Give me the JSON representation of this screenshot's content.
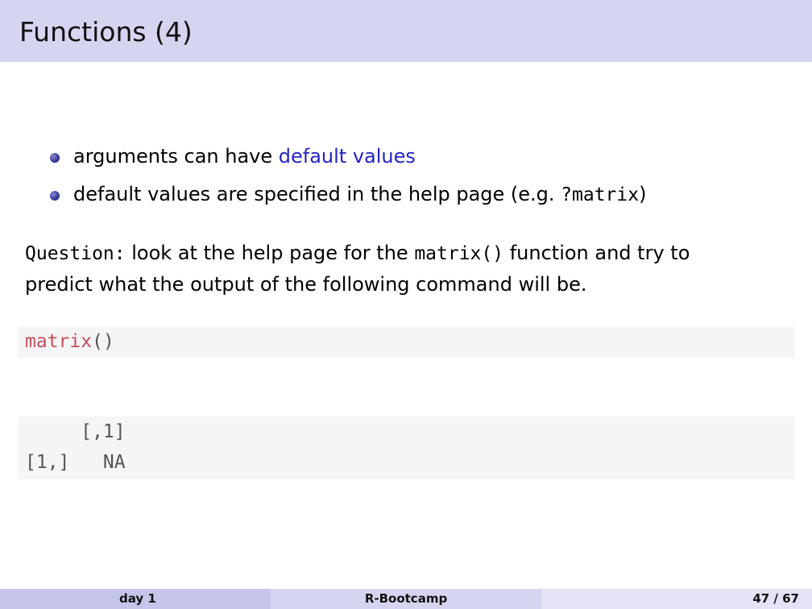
{
  "slide": {
    "title": "Functions (4)"
  },
  "bullets": [
    {
      "text": "arguments can have ",
      "highlight": "default values"
    },
    {
      "text": "default values are specified in the help page (e.g. ",
      "code": "?matrix",
      "suffix": ")"
    }
  ],
  "question": {
    "label": "Question:",
    "text1": " look at the help page for the ",
    "code": "matrix()",
    "text2": " function and try to",
    "line2": "predict what the output of the following command will be."
  },
  "code_input": {
    "function": "matrix",
    "args": "()"
  },
  "code_output": {
    "line1": "     [,1]",
    "line2": "[1,]   NA"
  },
  "footer": {
    "left": "day 1",
    "center": "R-Bootcamp",
    "right": "47 / 67"
  },
  "colors": {
    "header_bg": "#d5d5f0",
    "highlight": "#2323c8",
    "code_fn": "#c4515b",
    "codebox_bg": "#f5f5f5"
  }
}
